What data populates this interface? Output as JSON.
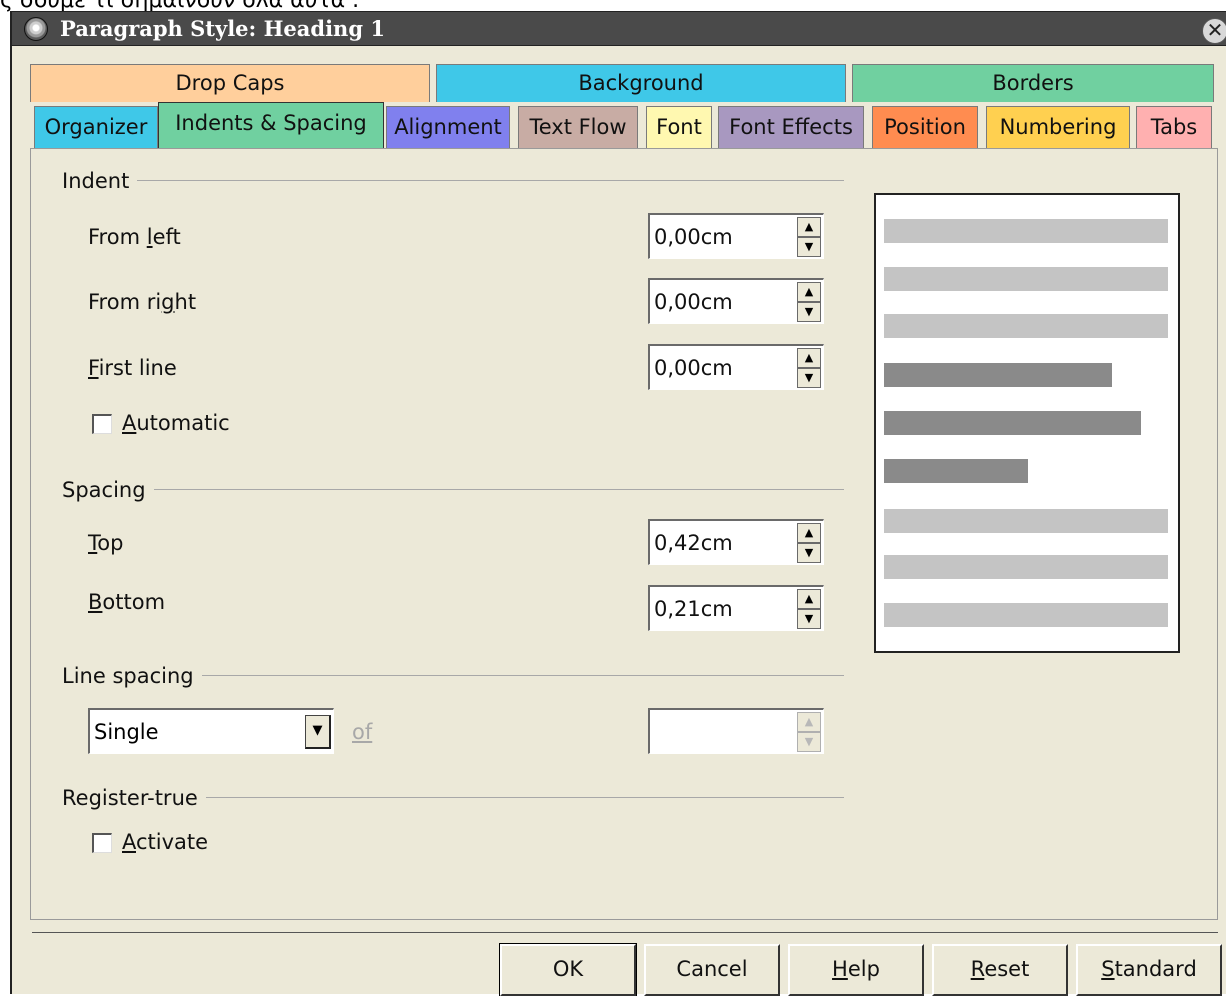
{
  "top_text": "ς σουμε τι σημαίνουν όλα αυτά .",
  "window": {
    "title": "Paragraph Style: Heading 1",
    "close_glyph": "✕"
  },
  "tabs_row1": [
    {
      "label": "Drop Caps",
      "color": "#ffcf9c"
    },
    {
      "label": "Background",
      "color": "#3fc8e8"
    },
    {
      "label": "Borders",
      "color": "#70d0a0"
    }
  ],
  "tabs_row2": [
    {
      "label": "Organizer",
      "color": "#3fc8e8"
    },
    {
      "label": "Indents & Spacing",
      "color": "#70d0a0",
      "active": true
    },
    {
      "label": "Alignment",
      "color": "#8080ee"
    },
    {
      "label": "Text Flow",
      "color": "#c8aca4"
    },
    {
      "label": "Font",
      "color": "#fff8b0"
    },
    {
      "label": "Font Effects",
      "color": "#a898c0"
    },
    {
      "label": "Position",
      "color": "#ff8c50"
    },
    {
      "label": "Numbering",
      "color": "#ffd050"
    },
    {
      "label": "Tabs",
      "color": "#ffb0b0"
    }
  ],
  "indent": {
    "group_label": "Indent",
    "from_left": {
      "label_pre": "From ",
      "label_u": "l",
      "label_post": "eft",
      "value": "0,00cm"
    },
    "from_right": {
      "label_pre": "From ri",
      "label_u": "g",
      "label_post": "ht",
      "value": "0,00cm"
    },
    "first_line": {
      "label_pre": "",
      "label_u": "F",
      "label_post": "irst line",
      "value": "0,00cm"
    },
    "automatic": {
      "label_pre": "",
      "label_u": "A",
      "label_post": "utomatic",
      "checked": false
    }
  },
  "spacing": {
    "group_label": "Spacing",
    "top": {
      "label_pre": "",
      "label_u": "T",
      "label_post": "op",
      "value": "0,42cm"
    },
    "bottom": {
      "label_pre": "",
      "label_u": "B",
      "label_post": "ottom",
      "value": "0,21cm"
    }
  },
  "line_spacing": {
    "group_label": "Line spacing",
    "selected": "Single",
    "of_label": "of",
    "value": ""
  },
  "register_true": {
    "group_label": "Register-true",
    "activate": {
      "label_pre": "",
      "label_u": "A",
      "label_post": "ctivate",
      "checked": false
    }
  },
  "buttons": {
    "ok": "OK",
    "cancel": "Cancel",
    "help": {
      "u": "H",
      "rest": "elp"
    },
    "reset": {
      "u": "R",
      "rest": "eset"
    },
    "standard": {
      "u": "S",
      "rest": "tandard"
    }
  },
  "arrows": {
    "up": "▲",
    "down": "▼"
  }
}
